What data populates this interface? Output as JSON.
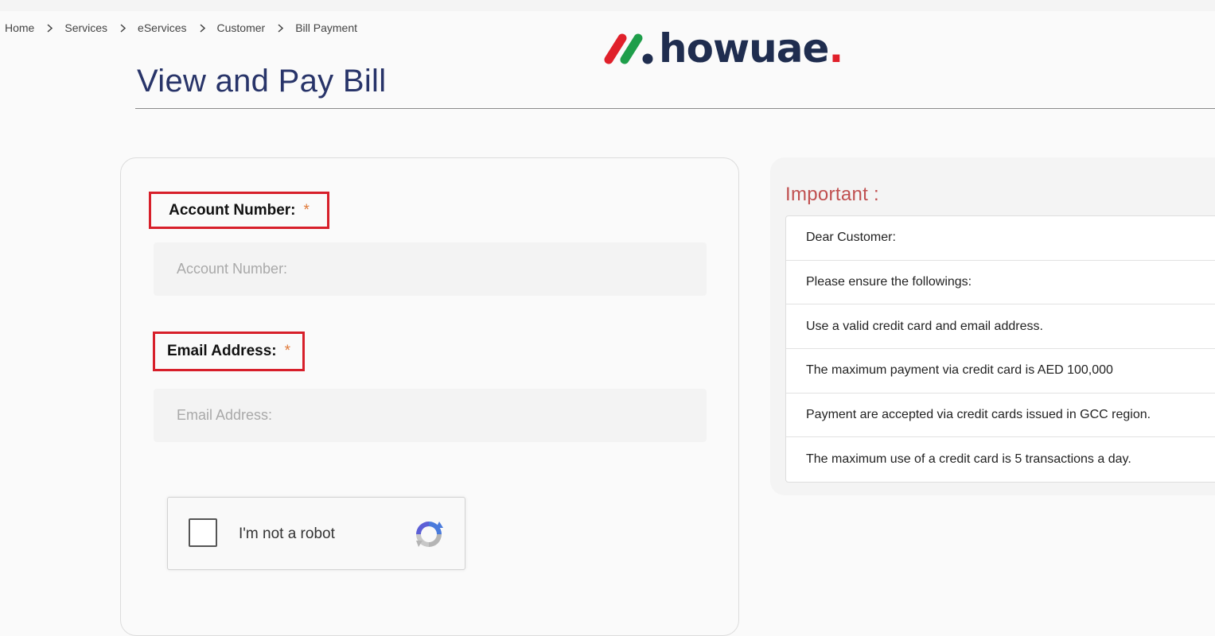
{
  "breadcrumb": [
    "Home",
    "Services",
    "eServices",
    "Customer",
    "Bill Payment"
  ],
  "logo": {
    "text": "howuae",
    "dot": ".",
    "colors": {
      "red": "#e0202a",
      "green": "#1e9e4a",
      "navy": "#1f2d4f"
    }
  },
  "page": {
    "title": "View and Pay Bill"
  },
  "form": {
    "account_label": "Account Number:",
    "account_placeholder": "Account Number:",
    "email_label": "Email Address:",
    "email_placeholder": "Email Address:",
    "required_mark": "*",
    "recaptcha_label": "I'm not a robot"
  },
  "important": {
    "title": "Important :",
    "items": [
      "Dear Customer:",
      "Please ensure the followings:",
      "Use a valid credit card and email address.",
      "The maximum payment via credit card is AED 100,000",
      "Payment are accepted via credit cards issued in GCC region.",
      "The maximum use of a credit card is 5 transactions a day."
    ]
  },
  "colors": {
    "title": "#283469",
    "highlight_border": "#d71f2a",
    "important_title": "#c05050"
  }
}
